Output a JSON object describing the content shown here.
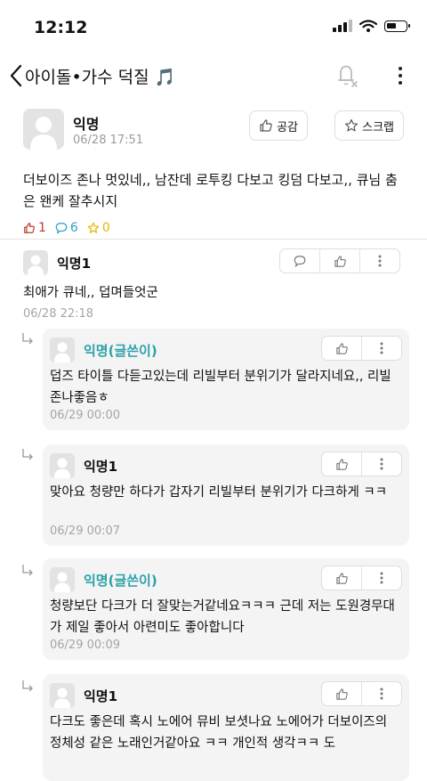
{
  "status": {
    "time": "12:12"
  },
  "nav": {
    "board_title": "아이돌•가수 덕질 🎵"
  },
  "post": {
    "author": "익명",
    "date": "06/28 17:51",
    "like_label": "공감",
    "scrap_label": "스크랩",
    "body": "더보이즈 존나 멋있네,, 남잔데 로투킹 다보고 킹덤 다보고,, 큐님 춤은 왠케 잘추시지",
    "counts": {
      "likes": "1",
      "comments": "6",
      "scraps": "0"
    }
  },
  "comments": [
    {
      "author": "익명1",
      "text": "최애가 큐네,, 덥며들엇군",
      "date": "06/28 22:18"
    }
  ],
  "replies": [
    {
      "author": "익명(글쓴이)",
      "writer": true,
      "text": "덥즈 타이틀 다듣고있는데 리빌부터 분위기가 달라지네요,, 리빌 존나좋음ㅎ",
      "date": "06/29 00:00"
    },
    {
      "author": "익명1",
      "writer": false,
      "text": "맞아요 청량만 하다가 갑자기 리빌부터 분위기가 다크하게 ㅋㅋ",
      "date": "06/29 00:07"
    },
    {
      "author": "익명(글쓴이)",
      "writer": true,
      "text": "청량보단 다크가 더 잘맞는거같네요ㅋㅋㅋ 근데 저는 도원경무대가 제일 좋아서 아련미도 좋아합니다",
      "date": "06/29 00:09"
    },
    {
      "author": "익명1",
      "writer": false,
      "text": "다크도 좋은데 혹시 노에어 뮤비 보셧나요 노에어가 더보이즈의 정체성 같은 노래인거같아요 ㅋㅋ 개인적 생각ㅋㅋ 도",
      "date": ""
    }
  ]
}
